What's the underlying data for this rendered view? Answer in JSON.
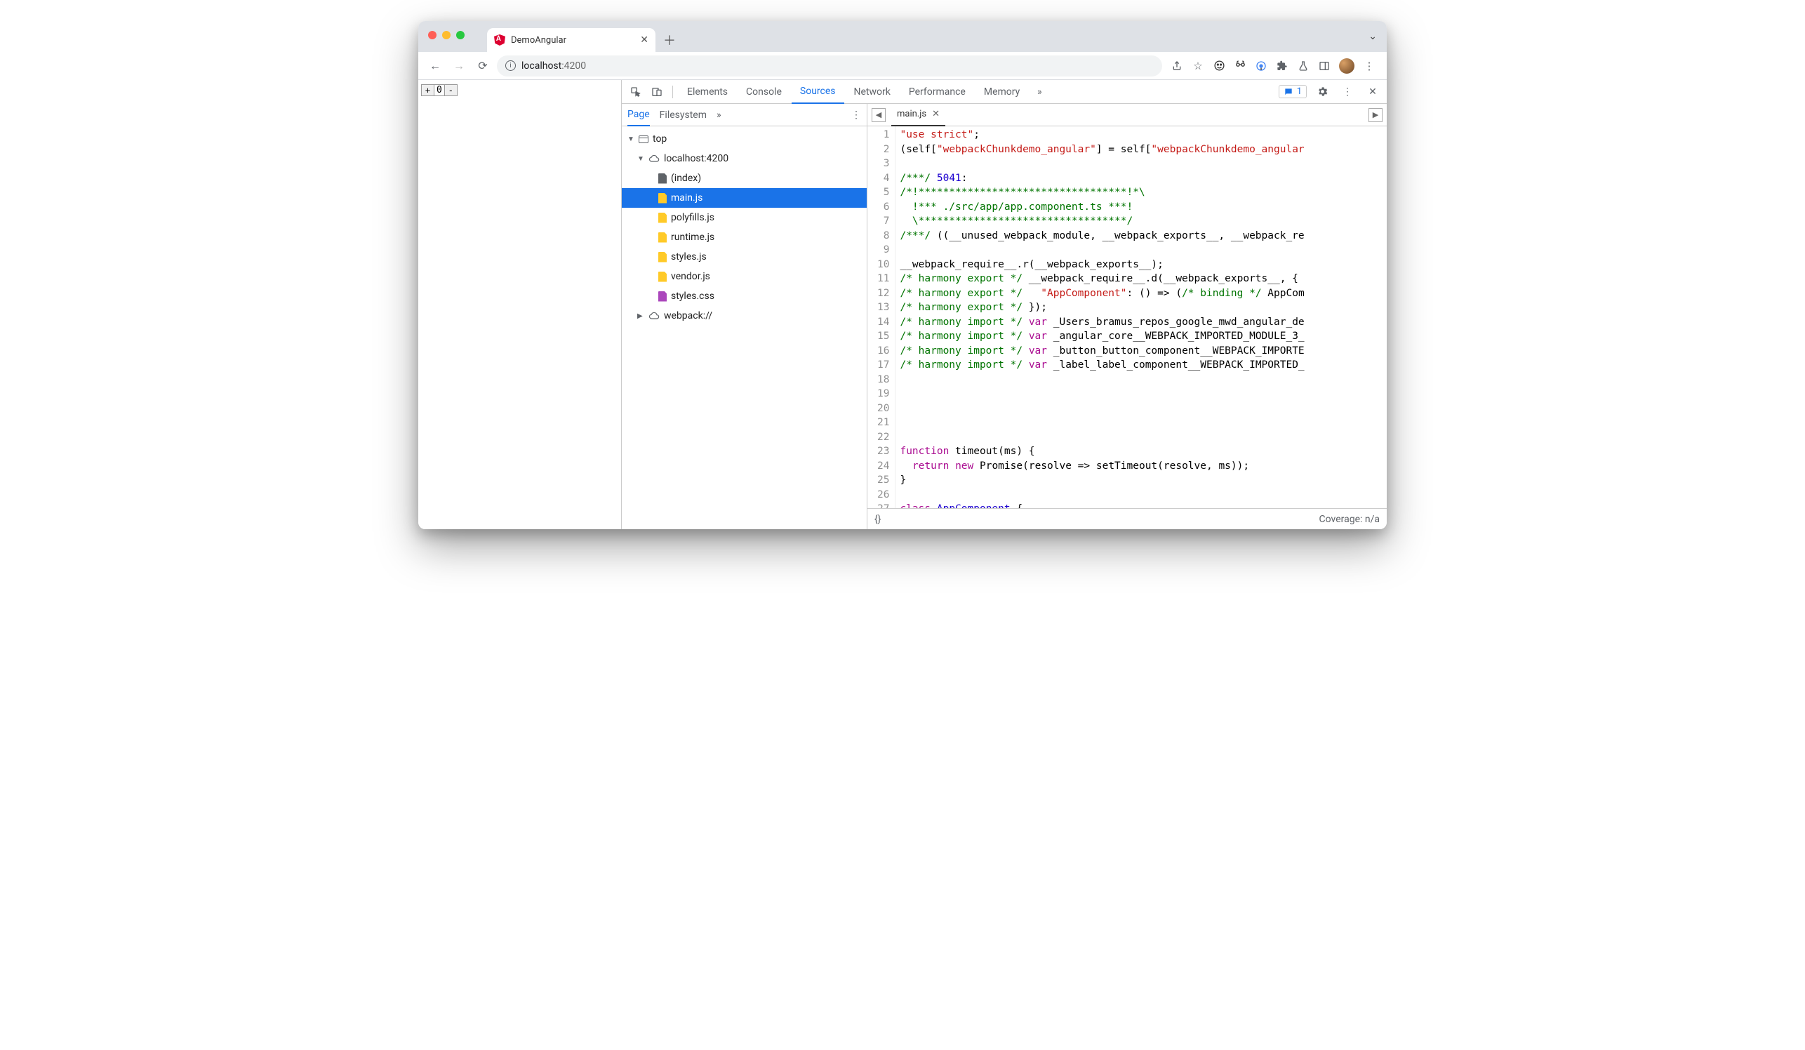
{
  "browser": {
    "tab_title": "DemoAngular",
    "url_host": "localhost",
    "url_port": ":4200"
  },
  "page": {
    "counter_value": "0"
  },
  "devtools": {
    "tabs": [
      "Elements",
      "Console",
      "Sources",
      "Network",
      "Performance",
      "Memory"
    ],
    "active_tab": "Sources",
    "issues_count": "1",
    "sources": {
      "subtabs": [
        "Page",
        "Filesystem"
      ],
      "active_subtab": "Page",
      "tree": {
        "top": "top",
        "host": "localhost:4200",
        "files": [
          "(index)",
          "main.js",
          "polyfills.js",
          "runtime.js",
          "styles.js",
          "vendor.js",
          "styles.css"
        ],
        "selected": "main.js",
        "webpack": "webpack://"
      }
    },
    "editor": {
      "open_file": "main.js",
      "footer_left": "{}",
      "footer_right": "Coverage: n/a",
      "lines": [
        [
          {
            "t": "str",
            "v": "\"use strict\""
          },
          {
            "t": "nm",
            "v": ";"
          }
        ],
        [
          {
            "t": "nm",
            "v": "(self["
          },
          {
            "t": "str",
            "v": "\"webpackChunkdemo_angular\""
          },
          {
            "t": "nm",
            "v": "] = self["
          },
          {
            "t": "str",
            "v": "\"webpackChunkdemo_angular"
          }
        ],
        [],
        [
          {
            "t": "cm",
            "v": "/***/ "
          },
          {
            "t": "num",
            "v": "5041"
          },
          {
            "t": "nm",
            "v": ":"
          }
        ],
        [
          {
            "t": "cm",
            "v": "/*!**********************************!*\\"
          }
        ],
        [
          {
            "t": "cm",
            "v": "  !*** ./src/app/app.component.ts ***!"
          }
        ],
        [
          {
            "t": "cm",
            "v": "  \\**********************************/"
          }
        ],
        [
          {
            "t": "cm",
            "v": "/***/"
          },
          {
            "t": "nm",
            "v": " ((__unused_webpack_module, __webpack_exports__, __webpack_re"
          }
        ],
        [],
        [
          {
            "t": "nm",
            "v": "__webpack_require__.r(__webpack_exports__);"
          }
        ],
        [
          {
            "t": "cm",
            "v": "/* harmony export */"
          },
          {
            "t": "nm",
            "v": " __webpack_require__.d(__webpack_exports__, {"
          }
        ],
        [
          {
            "t": "cm",
            "v": "/* harmony export */"
          },
          {
            "t": "nm",
            "v": "   "
          },
          {
            "t": "str",
            "v": "\"AppComponent\""
          },
          {
            "t": "nm",
            "v": ": () => ("
          },
          {
            "t": "cm",
            "v": "/* binding */"
          },
          {
            "t": "nm",
            "v": " AppCom"
          }
        ],
        [
          {
            "t": "cm",
            "v": "/* harmony export */"
          },
          {
            "t": "nm",
            "v": " });"
          }
        ],
        [
          {
            "t": "cm",
            "v": "/* harmony import */"
          },
          {
            "t": "nm",
            "v": " "
          },
          {
            "t": "kw",
            "v": "var"
          },
          {
            "t": "nm",
            "v": " _Users_bramus_repos_google_mwd_angular_de"
          }
        ],
        [
          {
            "t": "cm",
            "v": "/* harmony import */"
          },
          {
            "t": "nm",
            "v": " "
          },
          {
            "t": "kw",
            "v": "var"
          },
          {
            "t": "nm",
            "v": " _angular_core__WEBPACK_IMPORTED_MODULE_3_"
          }
        ],
        [
          {
            "t": "cm",
            "v": "/* harmony import */"
          },
          {
            "t": "nm",
            "v": " "
          },
          {
            "t": "kw",
            "v": "var"
          },
          {
            "t": "nm",
            "v": " _button_button_component__WEBPACK_IMPORTE"
          }
        ],
        [
          {
            "t": "cm",
            "v": "/* harmony import */"
          },
          {
            "t": "nm",
            "v": " "
          },
          {
            "t": "kw",
            "v": "var"
          },
          {
            "t": "nm",
            "v": " _label_label_component__WEBPACK_IMPORTED_"
          }
        ],
        [],
        [],
        [],
        [],
        [],
        [
          {
            "t": "kw",
            "v": "function"
          },
          {
            "t": "nm",
            "v": " timeout(ms) {"
          }
        ],
        [
          {
            "t": "nm",
            "v": "  "
          },
          {
            "t": "kw",
            "v": "return"
          },
          {
            "t": "nm",
            "v": " "
          },
          {
            "t": "kw",
            "v": "new"
          },
          {
            "t": "nm",
            "v": " Promise(resolve => setTimeout(resolve, ms));"
          }
        ],
        [
          {
            "t": "nm",
            "v": "}"
          }
        ],
        [],
        [
          {
            "t": "kw",
            "v": "class"
          },
          {
            "t": "nm",
            "v": " "
          },
          {
            "t": "idb",
            "v": "AppComponent"
          },
          {
            "t": "nm",
            "v": " {"
          }
        ]
      ]
    }
  }
}
